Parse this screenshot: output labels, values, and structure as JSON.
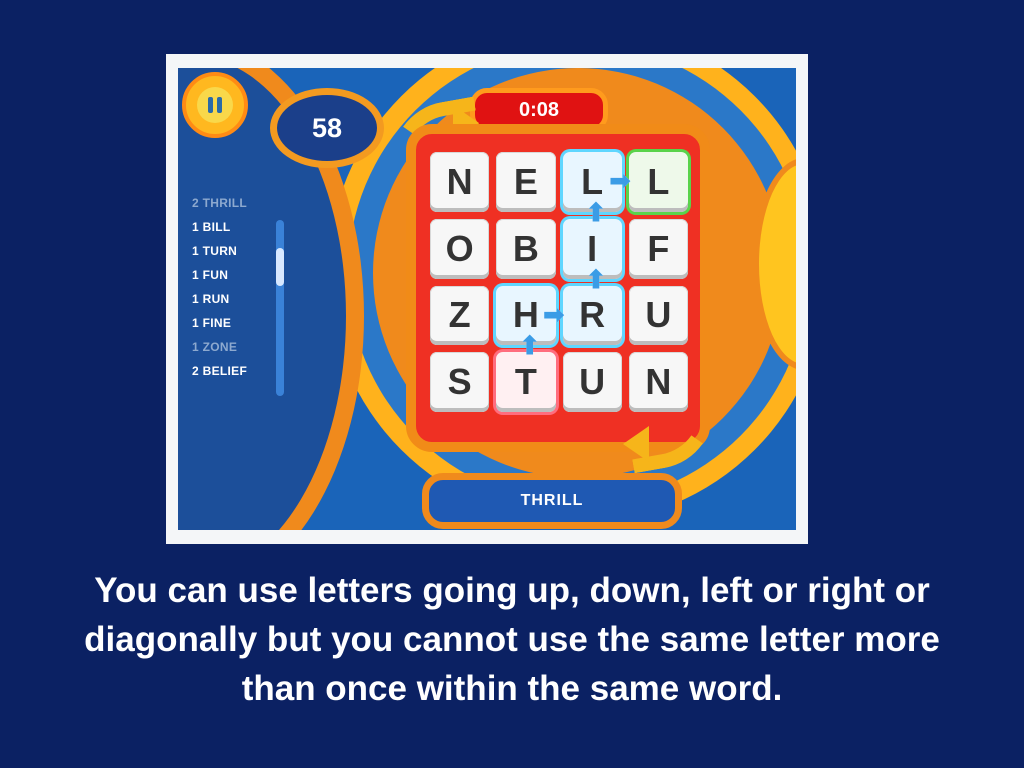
{
  "game": {
    "score": "58",
    "timer": "0:08",
    "current_word": "THRILL",
    "word_list": [
      {
        "text": "2 THRILL",
        "dim": true
      },
      {
        "text": "1 BILL",
        "dim": false
      },
      {
        "text": "1 TURN",
        "dim": false
      },
      {
        "text": "1 FUN",
        "dim": false
      },
      {
        "text": "1 RUN",
        "dim": false
      },
      {
        "text": "1 FINE",
        "dim": false
      },
      {
        "text": "1 ZONE",
        "dim": true
      },
      {
        "text": "2 BELIEF",
        "dim": false
      }
    ],
    "board": [
      [
        "N",
        "E",
        "L",
        "L"
      ],
      [
        "O",
        "B",
        "I",
        "F"
      ],
      [
        "Z",
        "H",
        "R",
        "U"
      ],
      [
        "S",
        "T",
        "U",
        "N"
      ]
    ],
    "highlighted_tiles": [
      {
        "row": 0,
        "col": 2,
        "style": "cyan"
      },
      {
        "row": 0,
        "col": 3,
        "style": "green"
      },
      {
        "row": 1,
        "col": 2,
        "style": "cyan"
      },
      {
        "row": 2,
        "col": 1,
        "style": "cyan"
      },
      {
        "row": 2,
        "col": 2,
        "style": "cyan"
      },
      {
        "row": 3,
        "col": 1,
        "style": "red"
      }
    ],
    "arrows": [
      {
        "row": 0,
        "col": 2,
        "dir": "right",
        "glyph": "➡"
      },
      {
        "row": 1,
        "col": 2,
        "dir": "up",
        "glyph": "⬆"
      },
      {
        "row": 2,
        "col": 2,
        "dir": "up",
        "glyph": "⬆"
      },
      {
        "row": 2,
        "col": 1,
        "dir": "right",
        "glyph": "➡"
      },
      {
        "row": 3,
        "col": 1,
        "dir": "up",
        "glyph": "⬆"
      }
    ]
  },
  "caption": {
    "text": "You can use letters going up, down, left or right or diagonally but you cannot use the same letter more than once within the same word."
  },
  "colors": {
    "slide_background": "#0b2163",
    "board_red": "#ef3023",
    "orange": "#f08a1c",
    "yellow": "#ffb21c",
    "blue": "#1a64b9"
  },
  "icons": {
    "pause": "pause-icon",
    "rotate_left": "rotate-arrow-icon",
    "rotate_right": "rotate-arrow-icon"
  }
}
